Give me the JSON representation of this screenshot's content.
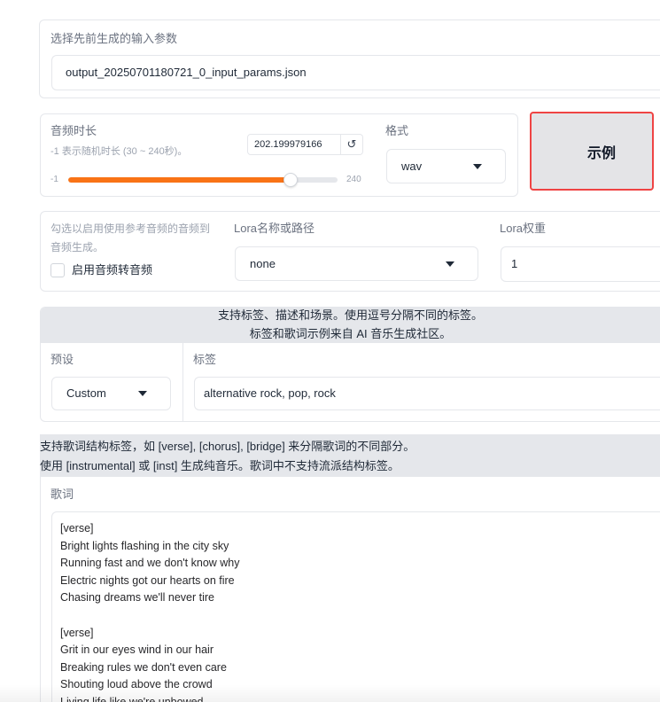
{
  "params_select": {
    "label": "选择先前生成的输入参数",
    "value": "output_20250701180721_0_input_params.json"
  },
  "duration": {
    "label": "音频时长",
    "info": "-1 表示随机时长 (30 ~ 240秒)。",
    "value": "202.199979166",
    "min": -1,
    "max": 240
  },
  "format": {
    "label": "格式",
    "value": "wav"
  },
  "example_button": {
    "label": "示例"
  },
  "audio2audio": {
    "info": "勾选以启用使用参考音频的音频到音频生成。",
    "checkbox_label": "启用音频转音频",
    "checked": false
  },
  "lora": {
    "name_label": "Lora名称或路径",
    "name_value": "none",
    "weight_label": "Lora权重",
    "weight_value": "1"
  },
  "tags_section": {
    "info_lines": [
      "支持标签、描述和场景。使用逗号分隔不同的标签。",
      "标签和歌词示例来自 AI 音乐生成社区。"
    ],
    "preset_label": "预设",
    "preset_value": "Custom",
    "tags_label": "标签",
    "tags_value": "alternative rock, pop, rock"
  },
  "lyrics_section": {
    "info_lines": [
      "支持歌词结构标签，如 [verse], [chorus], [bridge] 来分隔歌词的不同部分。",
      "使用 [instrumental] 或 [inst] 生成纯音乐。歌词中不支持流派结构标签。"
    ],
    "label": "歌词",
    "value": "[verse]\nBright lights flashing in the city sky\nRunning fast and we don't know why\nElectric nights got our hearts on fire\nChasing dreams we'll never tire\n\n[verse]\nGrit in our eyes wind in our hair\nBreaking rules we don't even care\nShouting loud above the crowd\nLiving life like we're unbowed"
  },
  "icons": {
    "reset": "↺",
    "reset_name": "reset-icon",
    "dropdown_name": "chevron-down-icon"
  },
  "theme": {
    "accent": "#f97316",
    "highlight_border": "#ef4444",
    "band_background": "#e5e7eb"
  }
}
